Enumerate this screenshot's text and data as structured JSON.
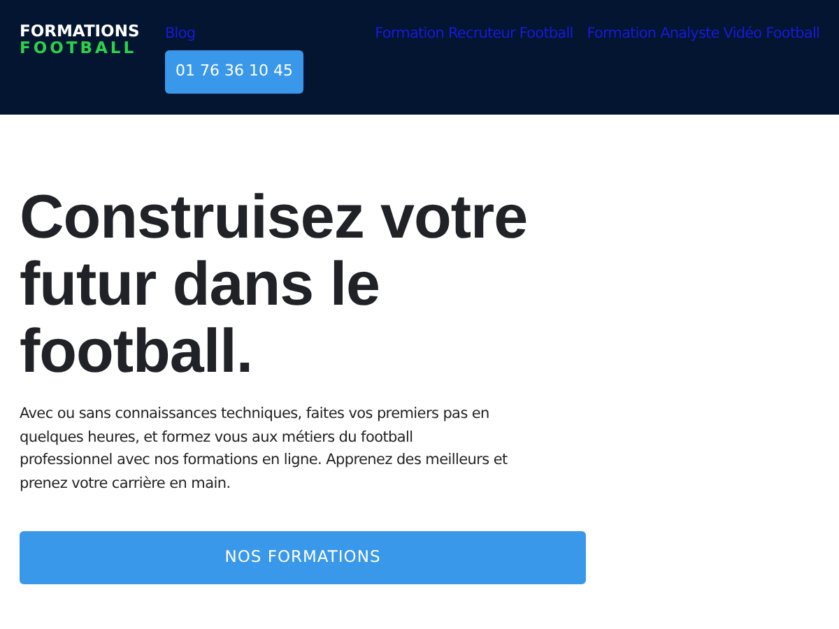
{
  "header": {
    "logo": {
      "line_1": "FORMATIONS",
      "line_2": "FOOTBALL"
    },
    "nav_links": [
      "Blog",
      "Formation Recruteur Football",
      "Formation Analyste Vidéo Football"
    ],
    "phone_button": "01 76 36 10 45"
  },
  "hero": {
    "heading": "Construisez votre futur dans le football.",
    "text": "Avec ou sans connaissances techniques, faites vos premiers pas en quelques heures, et formez vous aux métiers du football professionnel avec nos formations en ligne. Apprenez des meilleurs et prenez votre carrière en main.",
    "button": "NOS FORMATIONS"
  }
}
